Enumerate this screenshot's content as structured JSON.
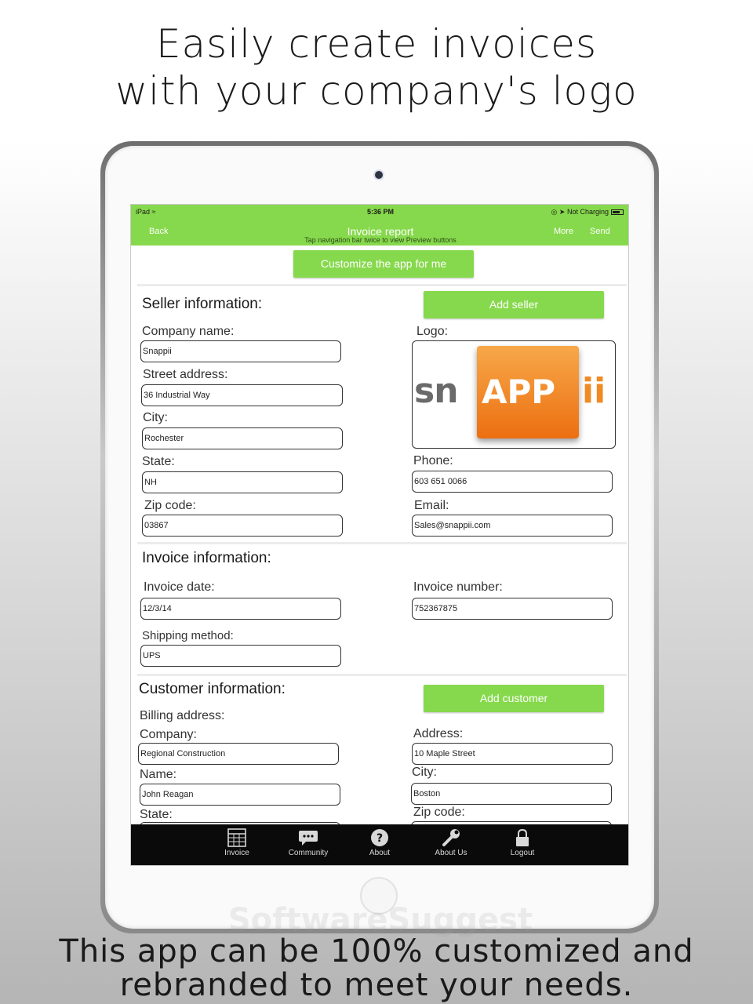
{
  "promo": {
    "headline_line1": "Easily create invoices",
    "headline_line2": "with your company's logo",
    "footer_line1": "This app can be 100% customized and",
    "footer_line2": "rebranded to meet your needs.",
    "watermark": "SoftwareSuggest"
  },
  "status_bar": {
    "device": "iPad",
    "time": "5:36 PM",
    "charging": "Not Charging"
  },
  "nav": {
    "back": "Back",
    "title": "Invoice report",
    "hint": "Tap navigation bar twice to view Preview buttons",
    "more": "More",
    "send": "Send"
  },
  "customize_button": "Customize the app for me",
  "seller": {
    "title": "Seller information:",
    "add_button": "Add seller",
    "company_label": "Company name:",
    "company": "Snappii",
    "street_label": "Street address:",
    "street": "36 Industrial Way",
    "city_label": "City:",
    "city": "Rochester",
    "state_label": "State:",
    "state": "NH",
    "zip_label": "Zip code:",
    "zip": "03867",
    "logo_label": "Logo:",
    "logo_text_left": "sn",
    "logo_text_center": "APP",
    "logo_text_right": "ii",
    "phone_label": "Phone:",
    "phone": "603 651 0066",
    "email_label": "Email:",
    "email": "Sales@snappii.com"
  },
  "invoice": {
    "title": "Invoice information:",
    "date_label": "Invoice date:",
    "date": "12/3/14",
    "number_label": "Invoice number:",
    "number": "752367875",
    "shipping_label": "Shipping method:",
    "shipping": "UPS"
  },
  "customer": {
    "title": "Customer information:",
    "add_button": "Add customer",
    "billing_label": "Billing address:",
    "company_label": "Company:",
    "company": "Regional Construction",
    "name_label": "Name:",
    "name": "John Reagan",
    "state_label": "State:",
    "address_label": "Address:",
    "address": "10 Maple Street",
    "city_label": "City:",
    "city": "Boston",
    "zip_label": "Zip code:"
  },
  "tabs": [
    {
      "label": "Invoice",
      "icon": "table-icon"
    },
    {
      "label": "Community",
      "icon": "chat-icon"
    },
    {
      "label": "About",
      "icon": "question-icon"
    },
    {
      "label": "About Us",
      "icon": "wrench-icon"
    },
    {
      "label": "Logout",
      "icon": "lock-icon"
    }
  ]
}
